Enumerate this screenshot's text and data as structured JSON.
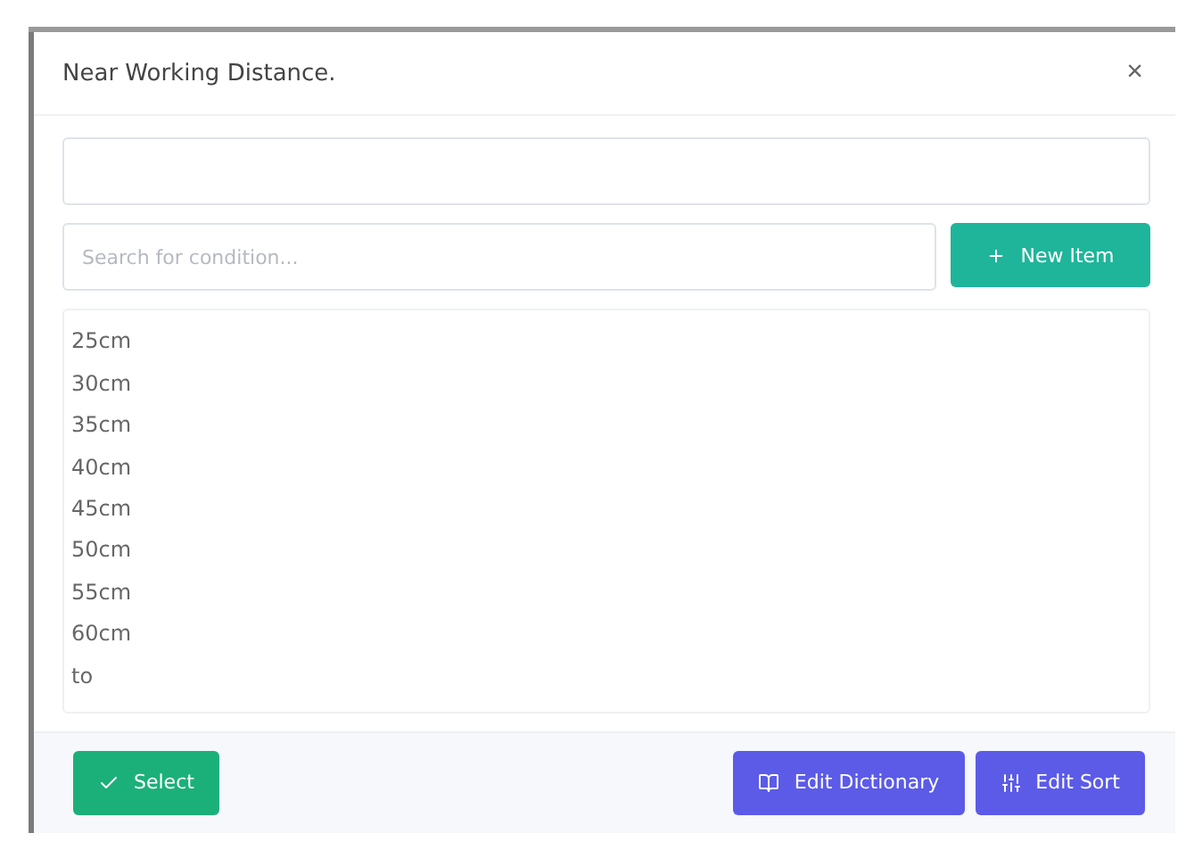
{
  "dialog": {
    "title": "Near Working Distance.",
    "close": "×"
  },
  "search": {
    "placeholder": "Search for condition..."
  },
  "new_button": {
    "label": "New Item"
  },
  "items": [
    {
      "label": "25cm"
    },
    {
      "label": "30cm"
    },
    {
      "label": "35cm"
    },
    {
      "label": "40cm"
    },
    {
      "label": "45cm"
    },
    {
      "label": "50cm"
    },
    {
      "label": "55cm"
    },
    {
      "label": "60cm"
    },
    {
      "label": "to"
    }
  ],
  "footer": {
    "select": "Select",
    "edit_dictionary": "Edit Dictionary",
    "edit_sort": "Edit Sort"
  }
}
